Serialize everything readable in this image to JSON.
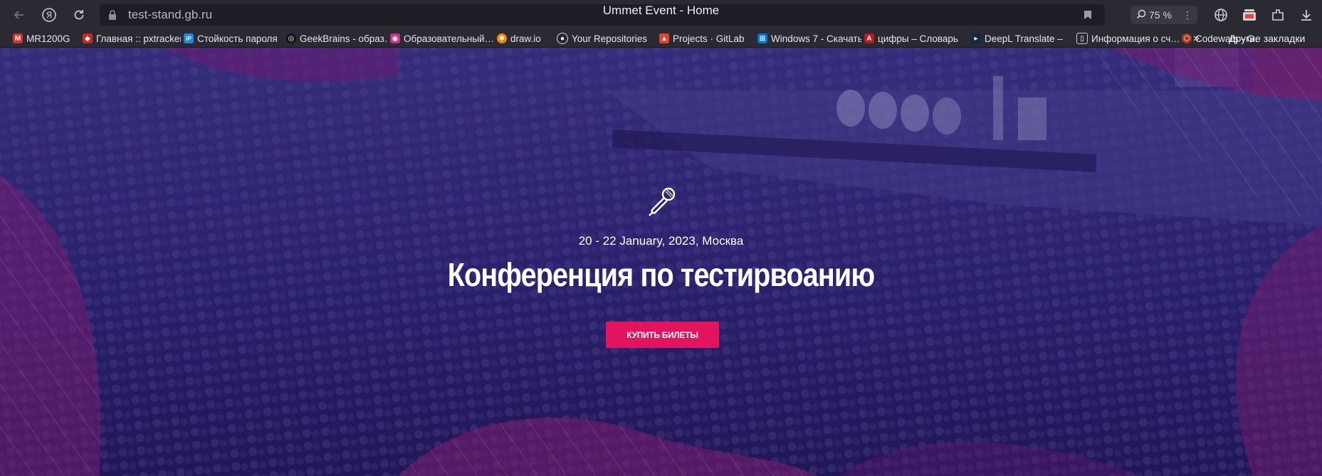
{
  "browser": {
    "url": "test-stand.gb.ru",
    "tab_title": "Ummet Event - Home",
    "zoom": "75 %",
    "icons": [
      "back-arrow-icon",
      "yandex-icon",
      "reload-icon",
      "lock-icon",
      "bookmark-icon",
      "zoom-icon",
      "kebab-menu-icon",
      "globe-icon",
      "collections-icon",
      "extensions-icon",
      "download-icon"
    ]
  },
  "bookmarks": {
    "items": [
      {
        "label": "MR1200G",
        "icon": "gmail-icon",
        "color": "#d93025",
        "glyph": "M"
      },
      {
        "label": "Главная :: pxtracker",
        "icon": "tracker-icon",
        "color": "#c62828",
        "glyph": "◆"
      },
      {
        "label": "Стойкость пароля",
        "icon": "ip-icon",
        "color": "#1e88e5",
        "glyph": "IP"
      },
      {
        "label": "GeekBrains - образ…",
        "icon": "geekbrains-icon",
        "color": "#111111",
        "glyph": "◎"
      },
      {
        "label": "Образовательный…",
        "icon": "instagram-icon",
        "color": "#c13584",
        "glyph": "◉"
      },
      {
        "label": "draw.io",
        "icon": "drawio-icon",
        "color": "#f08705",
        "glyph": "✱"
      },
      {
        "label": "Your Repositories",
        "icon": "github-icon",
        "color": "#24292e",
        "glyph": "●"
      },
      {
        "label": "Projects · GitLab",
        "icon": "gitlab-icon",
        "color": "#e24329",
        "glyph": "▲"
      },
      {
        "label": "Windows 7 - Скачать",
        "icon": "windows-icon",
        "color": "#0078d7",
        "glyph": "⊞"
      },
      {
        "label": "цифры – Словарь",
        "icon": "translate-icon",
        "color": "#b71c1c",
        "glyph": "A"
      },
      {
        "label": "DeepL Translate –",
        "icon": "deepl-icon",
        "color": "#0f2b46",
        "glyph": "▸"
      },
      {
        "label": "Информация о сч…",
        "icon": "document-icon",
        "color": "#2b2a33",
        "glyph": "▯"
      },
      {
        "label": "Codewars - G…",
        "icon": "codewars-icon",
        "color": "#b1361e",
        "glyph": "⬡"
      }
    ],
    "more": "»",
    "other": "Другие закладки"
  },
  "hero": {
    "icon": "microphone-icon",
    "date": "20 - 22 January, 2023, Москва",
    "title": "Конференция по тестирвоанию",
    "cta_label": "КУПИТЬ БИЛЕТЫ",
    "colors": {
      "overlay": "#2a1a62",
      "accent": "#e3145e",
      "wave": "#6a1a78"
    }
  }
}
